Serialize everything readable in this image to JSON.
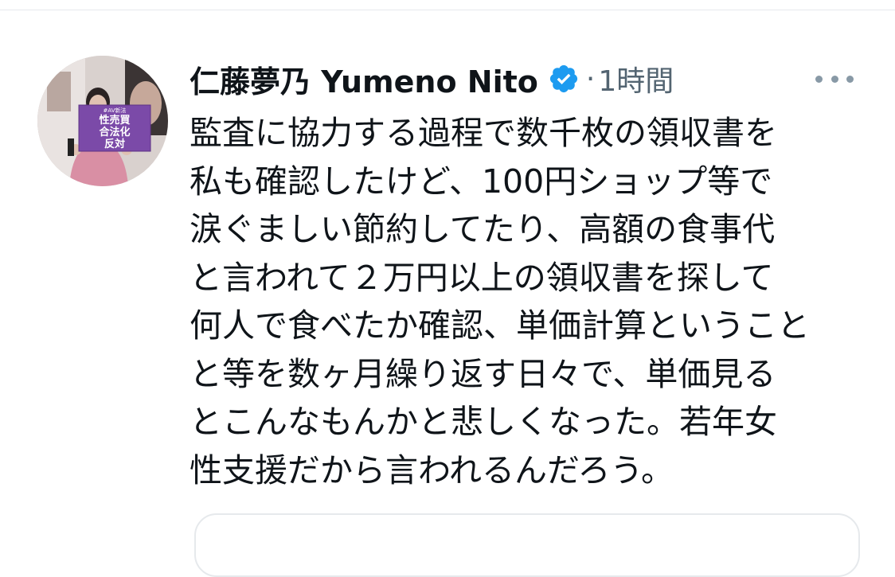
{
  "tweet": {
    "display_name": "仁藤夢乃  Yumeno Nito",
    "separator": "·",
    "time": "1時間",
    "lines": [
      "監査に協力する過程で数千枚の領収書を",
      "私も確認したけど、100円ショップ等で",
      "涙ぐましい節約してたり、高額の食事代",
      "と言われて２万円以上の領収書を探して",
      "何人で食べたか確認、単価計算ということ",
      "と等を数ヶ月繰り返す日々で、単価見る",
      "とこんなもんかと悲しくなった。若年女",
      "性支援だから言われるんだろう。"
    ],
    "avatar_sign_lines": [
      "性売買",
      "合法化",
      "反対"
    ],
    "avatar_sign_small": "#AV新法"
  },
  "icons": {
    "verified": "verified-badge-icon",
    "more": "more-options-icon"
  },
  "colors": {
    "text": "#0f1419",
    "muted": "#536471",
    "verified_blue": "#1d9bf0",
    "sign_purple": "#7b4aa8",
    "divider": "#e6e9ec"
  }
}
